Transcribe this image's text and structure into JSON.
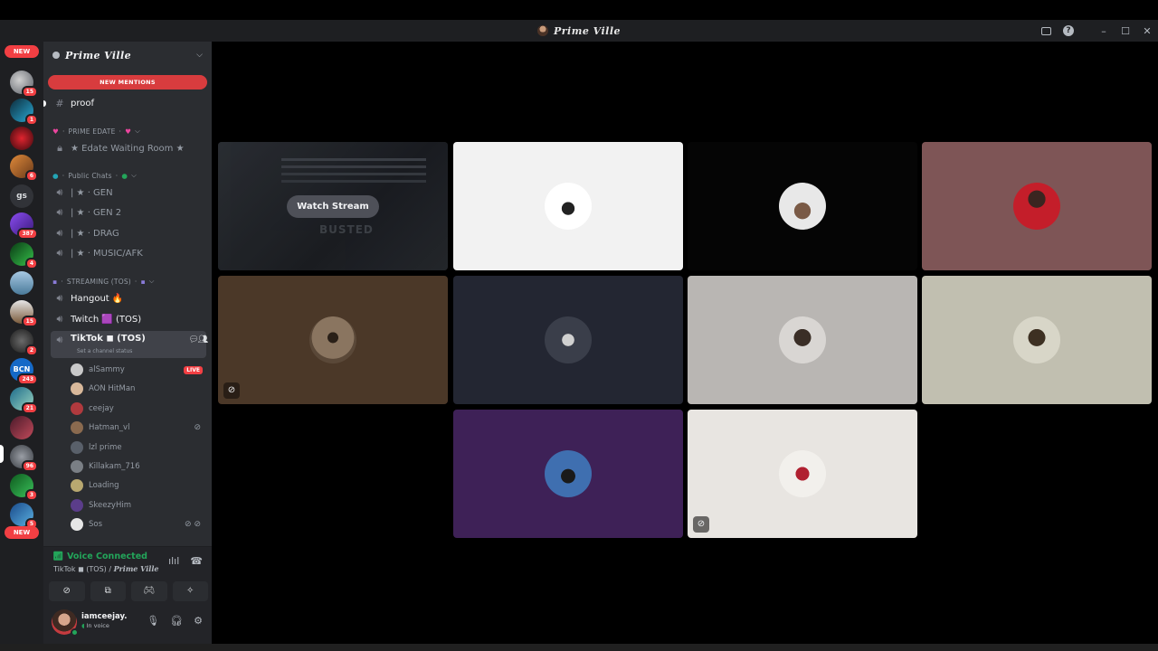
{
  "window": {
    "title": "Prime Ville"
  },
  "rail": {
    "top_pill": "NEW",
    "bottom_pill": "NEW",
    "servers": [
      {
        "name": "server-1",
        "badge": "15",
        "color": "#8a8f98"
      },
      {
        "name": "server-2",
        "badge": "1",
        "color": "#1f8fb2"
      },
      {
        "name": "server-3",
        "badge": "",
        "color": "#b0141e"
      },
      {
        "name": "server-4",
        "badge": "6",
        "color": "#c06a2a"
      },
      {
        "name": "gs",
        "badge": "",
        "label": "gs"
      },
      {
        "name": "server-6",
        "badge": "387",
        "color": "#6b2fd6"
      },
      {
        "name": "server-7",
        "badge": "4",
        "color": "#1a7a2e"
      },
      {
        "name": "server-8",
        "badge": "",
        "color": "#5c8fb8"
      },
      {
        "name": "server-9",
        "badge": "15",
        "color": "#8b6a4f"
      },
      {
        "name": "server-10",
        "badge": "2",
        "color": "#3a3a3a"
      },
      {
        "name": "server-11",
        "badge": "243",
        "color": "#1569c7",
        "label": "BCN"
      },
      {
        "name": "server-12",
        "badge": "21",
        "color": "#1d6b8a"
      },
      {
        "name": "server-13",
        "badge": "",
        "color": "#7a1f2f"
      },
      {
        "name": "server-14",
        "badge": "96",
        "color": "#5b5f66"
      },
      {
        "name": "server-15",
        "badge": "3",
        "color": "#1a9a3a"
      },
      {
        "name": "server-16",
        "badge": "5",
        "color": "#2a7ac7"
      }
    ]
  },
  "sidebar": {
    "guild_name": "Prime Ville",
    "new_mentions": "NEW MENTIONS",
    "proof": "proof",
    "cat_prime": "PRIME EDATE",
    "edate": "★ Edate Waiting Room ★",
    "cat_public": "Public Chats",
    "gen": "| ★ · GEN",
    "gen2": "| ★ · GEN 2",
    "drag": "| ★ · DRAG",
    "music": "| ★ · MUSIC/AFK",
    "cat_streaming": "STREAMING (TOS)",
    "hangout": "Hangout 🔥",
    "twitch": "Twitch 🟪 (TOS)",
    "tiktok": "TikTok ◼ (TOS)",
    "tiktok_status": "Set a channel status",
    "live_label": "LIVE",
    "users": [
      {
        "name": "alSammy",
        "color": "#c9c9c9"
      },
      {
        "name": "AON HitMan",
        "color": "#d8b89a"
      },
      {
        "name": "ceejay",
        "color": "#b03a3e"
      },
      {
        "name": "Hatman_vl",
        "color": "#8a6a4f"
      },
      {
        "name": "lzl prime",
        "color": "#59606a"
      },
      {
        "name": "Killakam_716",
        "color": "#7a7f85"
      },
      {
        "name": "Loading",
        "color": "#b8a870"
      },
      {
        "name": "SkeezyHim",
        "color": "#5b3d8a"
      },
      {
        "name": "Sos",
        "color": "#e6e6e6"
      }
    ]
  },
  "voice": {
    "status": "Voice Connected",
    "channel": "TikTok ◼ (TOS) / ",
    "server": "Prime Ville"
  },
  "user": {
    "name": "iamceejay.",
    "status": "In voice"
  },
  "stage": {
    "watch_stream": "Watch Stream",
    "stream_bg_text": "BUSTED",
    "tiles": [
      {
        "name": "tile-mickey",
        "bg": "#f2f2f2",
        "avatar": "#ffffff",
        "accent": "#222222"
      },
      {
        "name": "tile-white-hat",
        "bg": "#050505",
        "avatar": "#e8e8e8",
        "accent": "#7a5a46"
      },
      {
        "name": "tile-red-jacket",
        "bg": "#7e5556",
        "avatar": "#c41e2a",
        "accent": "#3a2520"
      },
      {
        "name": "tile-raccoon",
        "bg": "#4b3828",
        "avatar": "#8a7560",
        "accent": "#2a2018"
      },
      {
        "name": "tile-dark-user",
        "bg": "#232632",
        "avatar": "#3a3e4a",
        "accent": "#d0d0d0"
      },
      {
        "name": "tile-man-portrait",
        "bg": "#b9b6b3",
        "avatar": "#d9d6d3",
        "accent": "#3a2e26"
      },
      {
        "name": "tile-car-selfie",
        "bg": "#c1bfb0",
        "avatar": "#d8d6c8",
        "accent": "#3d3022"
      },
      {
        "name": "tile-purple-user",
        "bg": "#3e2157",
        "avatar": "#3f6fb0",
        "accent": "#1a1a1a"
      },
      {
        "name": "tile-basketball",
        "bg": "#e8e5e1",
        "avatar": "#f2f0ec",
        "accent": "#b02030"
      }
    ]
  }
}
